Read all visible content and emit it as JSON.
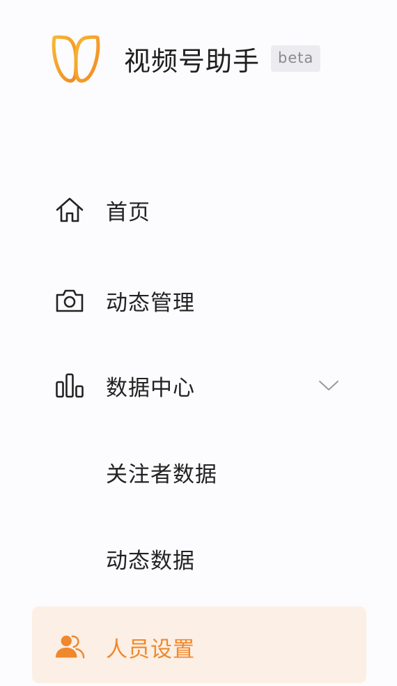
{
  "header": {
    "app_title": "视频号助手",
    "badge": "beta",
    "logo_icon": "infinity-wing-logo"
  },
  "menu": {
    "home": {
      "label": "首页",
      "icon": "home-icon"
    },
    "posts": {
      "label": "动态管理",
      "icon": "camera-icon"
    },
    "data_center": {
      "label": "数据中心",
      "icon": "bar-chart-icon",
      "expanded": true,
      "toggle_icon": "chevron-down-icon"
    },
    "followers_data": {
      "label": "关注者数据"
    },
    "post_data": {
      "label": "动态数据"
    },
    "members": {
      "label": "人员设置",
      "icon": "users-icon",
      "active": true
    }
  },
  "colors": {
    "accent": "#f0882c",
    "active_bg": "#fcefe5",
    "badge_bg": "#ecebef",
    "background": "#fcfbfd"
  }
}
